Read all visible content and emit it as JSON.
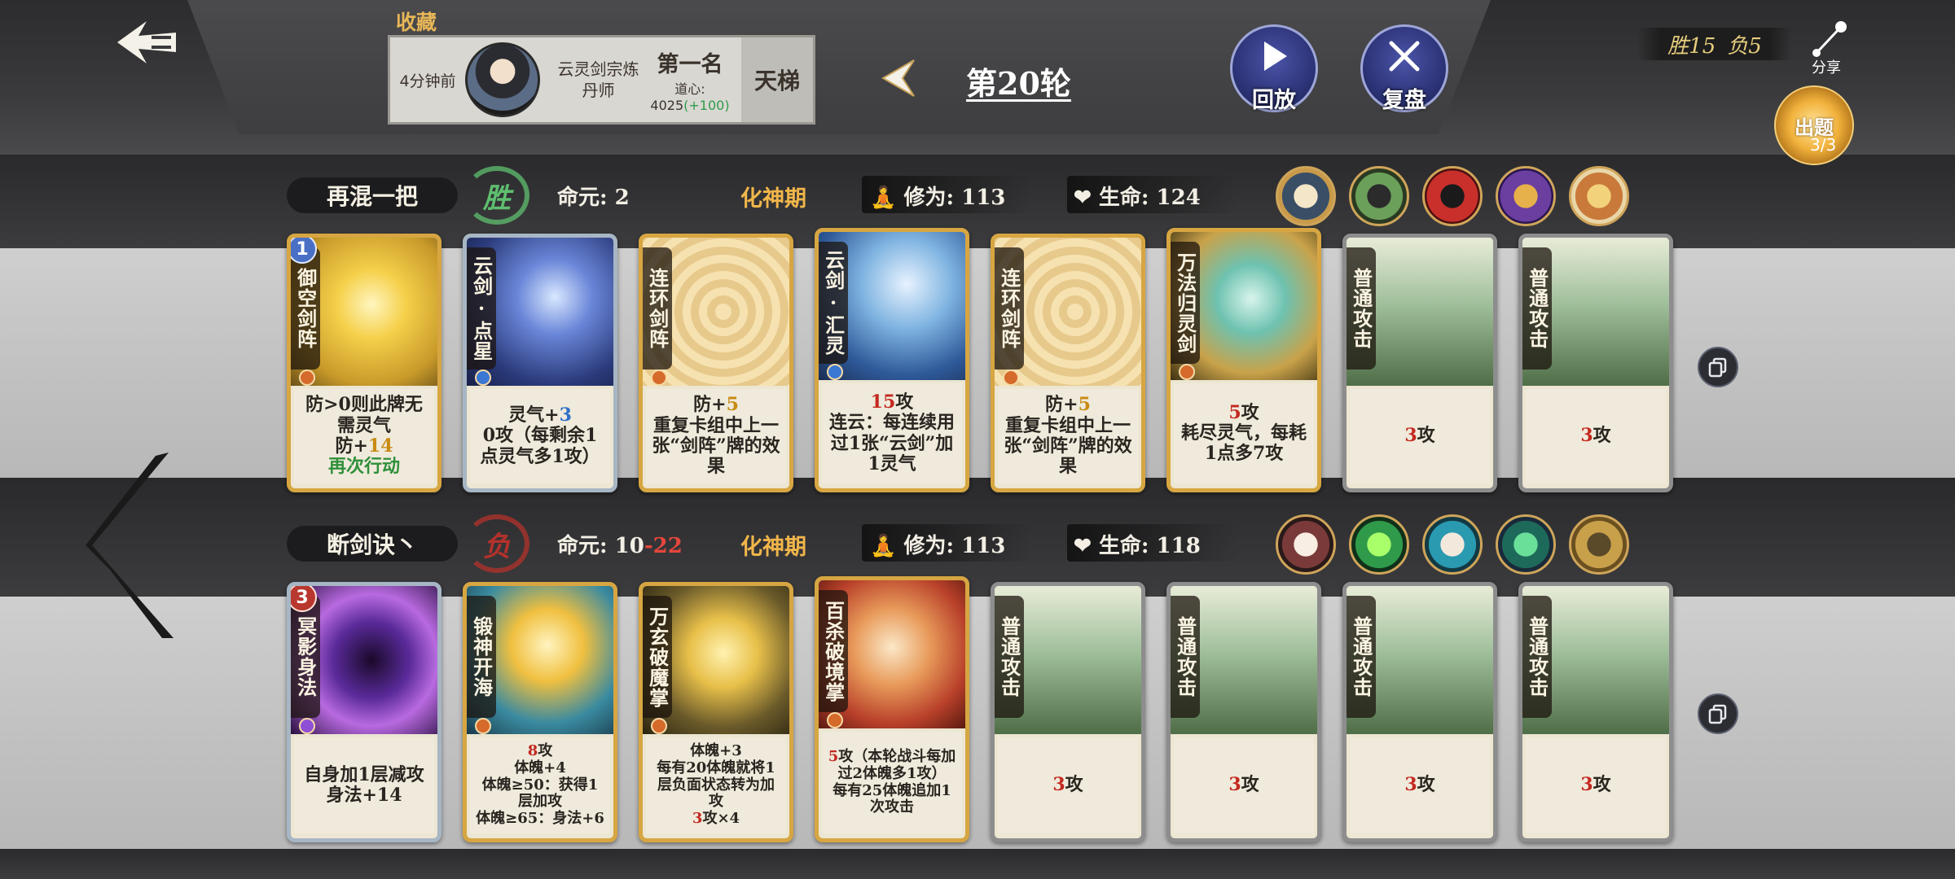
{
  "header": {
    "favorites_label": "收藏",
    "record": {
      "time_ago": "4分钟前",
      "opponent_name": "云灵剑宗炼丹师",
      "rank": "第一名",
      "dao_label": "道心:",
      "dao_value": "4025",
      "dao_gain": "(+100)",
      "mode": "天梯"
    },
    "round_label": "第20轮",
    "replay_label": "回放",
    "review_label": "复盘",
    "score": {
      "win": "胜15",
      "loss": "负5"
    },
    "share_label": "分享",
    "quest_label": "出题",
    "quest_count": "3/3"
  },
  "players": [
    {
      "name": "再混一把",
      "result": "胜",
      "result_type": "win",
      "life_label": "命元:",
      "life_value": "2",
      "life_loss": "",
      "realm": "化神期",
      "cultivation_label": "修为:",
      "cultivation_value": "113",
      "hp_label": "生命:",
      "hp_value": "124",
      "cards": [
        {
          "name": "御空剑阵",
          "badge": "1",
          "desc_a": "防>0则此牌无需灵气",
          "desc_b": "防+",
          "desc_b_num": "14",
          "desc_c": "再次行动"
        },
        {
          "name": "云剑·点星",
          "desc_a": "灵气+",
          "desc_a_num": "3",
          "desc_b": "0攻（每剩余1点灵气多1攻）"
        },
        {
          "name": "连环剑阵",
          "desc_a": "防+",
          "desc_a_num": "5",
          "desc_b": "重复卡组中上一张“剑阵”牌的效果"
        },
        {
          "name": "云剑·汇灵",
          "desc_a_num": "15",
          "desc_a": "攻",
          "desc_b": "连云：每连续用过1张“云剑”加1灵气"
        },
        {
          "name": "连环剑阵",
          "desc_a": "防+",
          "desc_a_num": "5",
          "desc_b": "重复卡组中上一张“剑阵”牌的效果"
        },
        {
          "name": "万法归灵剑",
          "desc_a_num": "5",
          "desc_a": "攻",
          "desc_b": "耗尽灵气，每耗1点多7攻"
        },
        {
          "name": "普通攻击",
          "desc_a_num": "3",
          "desc_a": "攻"
        },
        {
          "name": "普通攻击",
          "desc_a_num": "3",
          "desc_a": "攻"
        }
      ]
    },
    {
      "name": "断剑诀丶",
      "result": "负",
      "result_type": "lose",
      "life_label": "命元:",
      "life_value": "10",
      "life_loss": "-22",
      "realm": "化神期",
      "cultivation_label": "修为:",
      "cultivation_value": "113",
      "hp_label": "生命:",
      "hp_value": "118",
      "cards": [
        {
          "name": "冥影身法",
          "badge": "3",
          "desc_a": "自身加1层减攻",
          "desc_b": "身法+14"
        },
        {
          "name": "锻神开海",
          "desc_a_num": "8",
          "desc_a": "攻",
          "desc_b": "体魄+4",
          "desc_c": "体魄≥50：获得1层加攻",
          "desc_d": "体魄≥65：身法+6"
        },
        {
          "name": "万玄破魔掌",
          "desc_a": "体魄+3",
          "desc_b": "每有20体魄就将1层负面状态转为加攻",
          "desc_c": "3",
          "desc_d": "攻×4"
        },
        {
          "name": "百杀破境掌",
          "desc_a_num": "5",
          "desc_a": "攻（本轮战斗每加过2体魄多1攻）",
          "desc_b": "每有25体魄追加1次攻击"
        },
        {
          "name": "普通攻击",
          "desc_a_num": "3",
          "desc_a": "攻"
        },
        {
          "name": "普通攻击",
          "desc_a_num": "3",
          "desc_a": "攻"
        },
        {
          "name": "普通攻击",
          "desc_a_num": "3",
          "desc_a": "攻"
        },
        {
          "name": "普通攻击",
          "desc_a_num": "3",
          "desc_a": "攻"
        }
      ]
    }
  ],
  "colors": {
    "realm": "#f1b64a",
    "win": "#5fbf6f",
    "lose": "#b3322b",
    "loss_number": "#e4463c",
    "attack_number": "#c3281f",
    "defense_number": "#c98a12",
    "qi_number": "#2c6fc6"
  },
  "icons": {
    "back": "back-arrow-icon",
    "prev_round": "chevron-left-icon",
    "replay": "play-icon",
    "review": "crossed-swords-icon",
    "share": "share-icon",
    "copy": "copy-icon",
    "cultivation": "meditation-icon",
    "hp": "heart-icon"
  }
}
